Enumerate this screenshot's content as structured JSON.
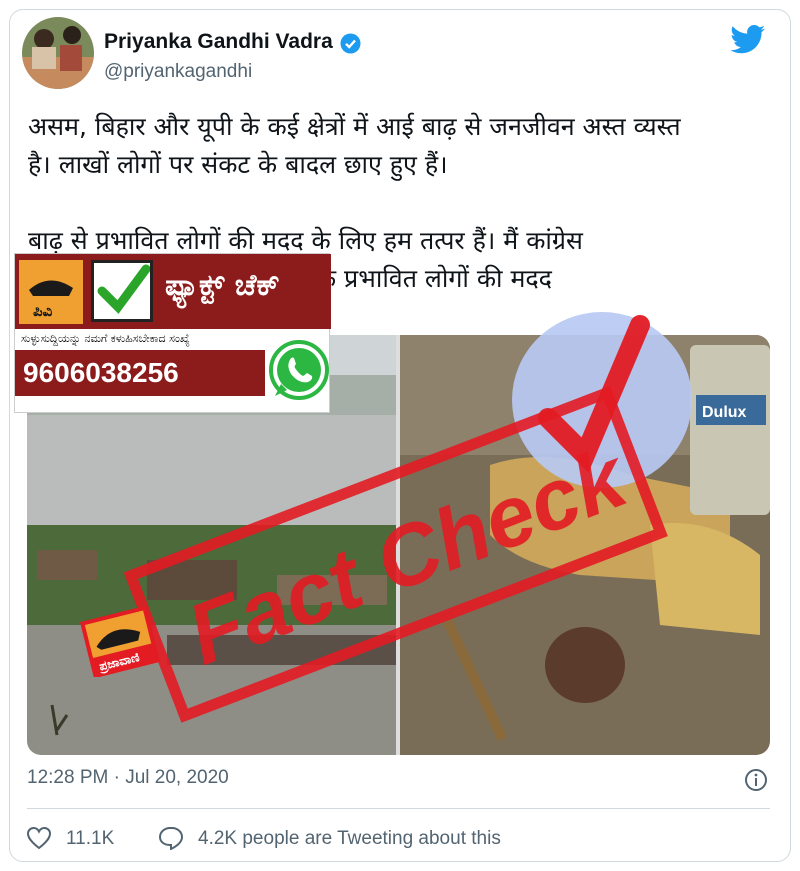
{
  "author": {
    "display_name": "Priyanka Gandhi Vadra",
    "handle": "@priyankagandhi"
  },
  "tweet": {
    "paragraph_1": "असम, बिहार और यूपी के कई क्षेत्रों में आई बाढ़ से जनजीवन अस्त व्यस्त\nहै। लाखों लोगों पर संकट के बादल छाए हुए हैं।",
    "paragraph_2": "बाढ़ से प्रभावित लोगों की मदद के लिए हम तत्पर हैं। मैं कांग्रेस\nकार्यकर्ताओं से अपील करती हूं कि प्रभावित लोगों की मदद\nकरें।",
    "timestamp": "12:28 PM · Jul 20, 2020"
  },
  "metrics": {
    "likes": "11.1K",
    "conversation": "4.2K people are Tweeting about this"
  },
  "overlay": {
    "factcheck_title": "ಫ್ಯಾಕ್ಟ್ ಚೆಕ್",
    "factcheck_subtitle": "ಸುಳ್ಳುಸುದ್ದಿಯನ್ನು ನಮಗೆ ಕಳುಹಿಸಬೇಕಾದ ಸಂಖ್ಯೆ",
    "logo_text": "ಪಿವಿ",
    "phone": "9606038256",
    "stamp_text": "Fact Check",
    "brand_text": "ಪ್ರಜಾವಾಣಿ"
  },
  "colors": {
    "twitter_blue": "#1d9bf0",
    "stamp_red": "#e31b23",
    "banner_red": "#8c1c1c",
    "muted_text": "#536471"
  },
  "icons": [
    "verified-icon",
    "twitter-bird-icon",
    "whatsapp-icon",
    "info-icon",
    "heart-icon",
    "speech-bubble-icon",
    "check-mark-icon"
  ]
}
